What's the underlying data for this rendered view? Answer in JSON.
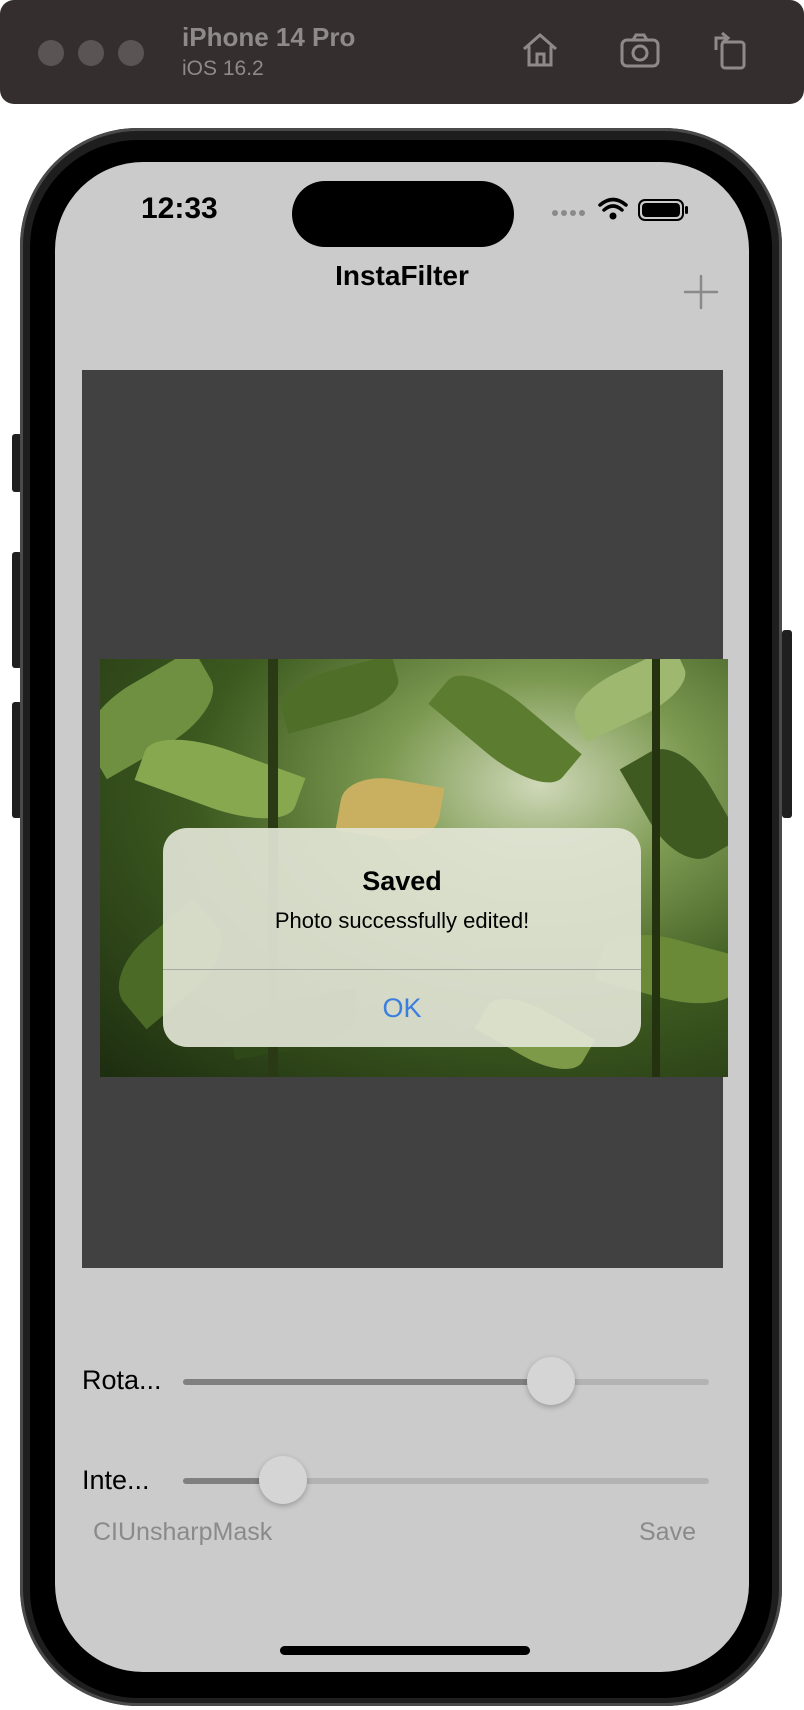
{
  "simulator": {
    "device_name": "iPhone 14 Pro",
    "os_version": "iOS 16.2",
    "icons": [
      "home-icon",
      "screenshot-icon",
      "rotate-icon"
    ]
  },
  "status_bar": {
    "time": "12:33"
  },
  "nav": {
    "title": "InstaFilter",
    "add_icon": "plus-icon"
  },
  "alert": {
    "title": "Saved",
    "message": "Photo successfully edited!",
    "ok_label": "OK"
  },
  "sliders": [
    {
      "label": "Rota...",
      "value_fraction": 0.7
    },
    {
      "label": "Inte...",
      "value_fraction": 0.19
    }
  ],
  "toolbar": {
    "filter_name": "CIUnsharpMask",
    "save_label": "Save"
  },
  "colors": {
    "accent": "#3a7ee0",
    "screen_bg": "#cbcbcb",
    "image_bg": "#414141"
  }
}
